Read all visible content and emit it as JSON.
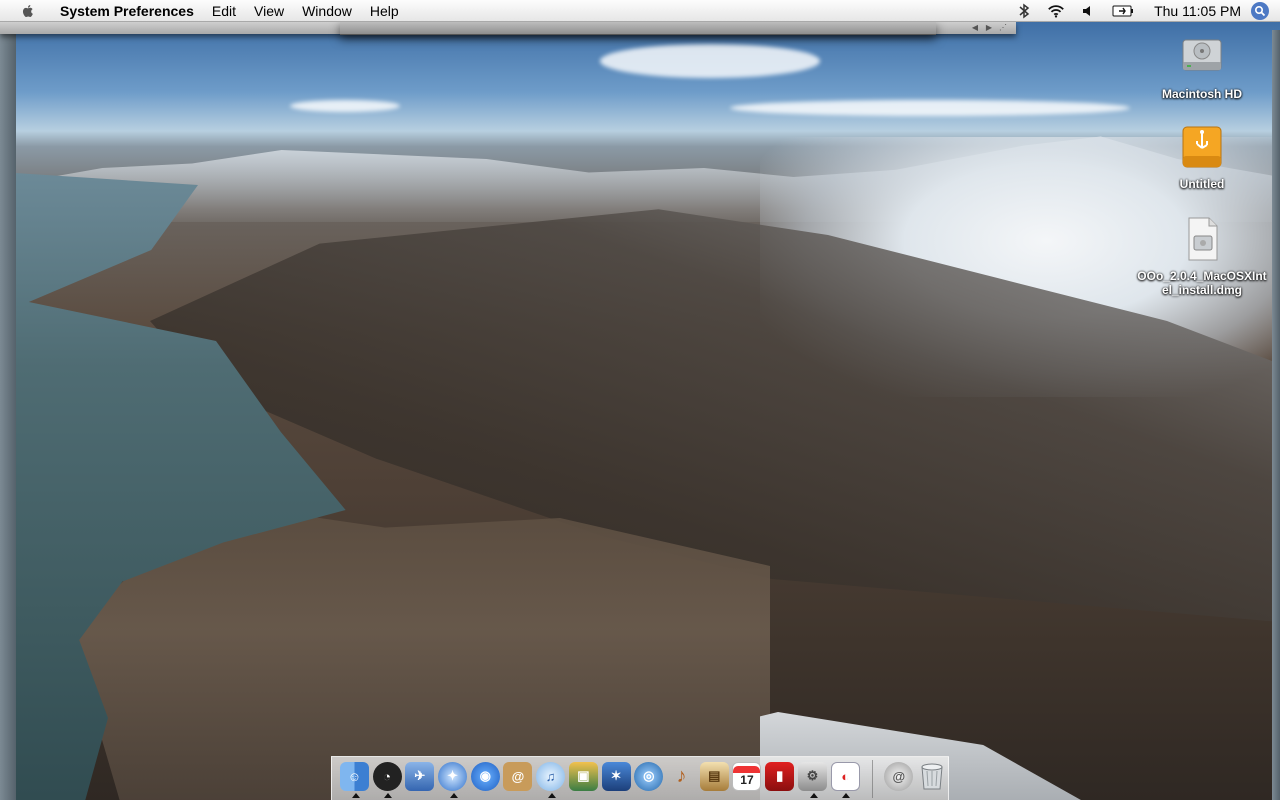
{
  "menubar": {
    "app_name": "System Preferences",
    "menus": [
      "Edit",
      "View",
      "Window",
      "Help"
    ],
    "clock": "Thu 11:05 PM",
    "status_icons": [
      "bluetooth-icon",
      "wifi-icon",
      "volume-icon",
      "battery-icon"
    ]
  },
  "desktop": {
    "icons": [
      {
        "label": "Macintosh HD",
        "icon": "hard-drive-icon"
      },
      {
        "label": "Untitled",
        "icon": "usb-drive-icon"
      },
      {
        "label": "OOo_2.0.4_MacOSXIntel_install.dmg",
        "icon": "disk-image-icon"
      }
    ]
  },
  "dock": {
    "apps": [
      {
        "icon": "finder-icon",
        "running": true
      },
      {
        "icon": "dashboard-icon",
        "running": true
      },
      {
        "icon": "mail-icon",
        "running": false
      },
      {
        "icon": "safari-icon",
        "running": true
      },
      {
        "icon": "ichat-icon",
        "running": false
      },
      {
        "icon": "address-book-icon",
        "running": false
      },
      {
        "icon": "itunes-icon",
        "running": true
      },
      {
        "icon": "iphoto-icon",
        "running": false
      },
      {
        "icon": "imovie-icon",
        "running": false
      },
      {
        "icon": "idvd-icon",
        "running": false
      },
      {
        "icon": "garageband-icon",
        "running": false
      },
      {
        "icon": "iweb-icon",
        "running": false
      },
      {
        "icon": "ical-icon",
        "running": false,
        "text": "17"
      },
      {
        "icon": "photo-booth-icon",
        "running": false
      },
      {
        "icon": "system-preferences-icon",
        "running": true
      },
      {
        "icon": "openoffice-icon",
        "running": true
      }
    ],
    "others": [
      {
        "icon": "downloads-stack-icon"
      },
      {
        "icon": "trash-icon"
      }
    ]
  }
}
